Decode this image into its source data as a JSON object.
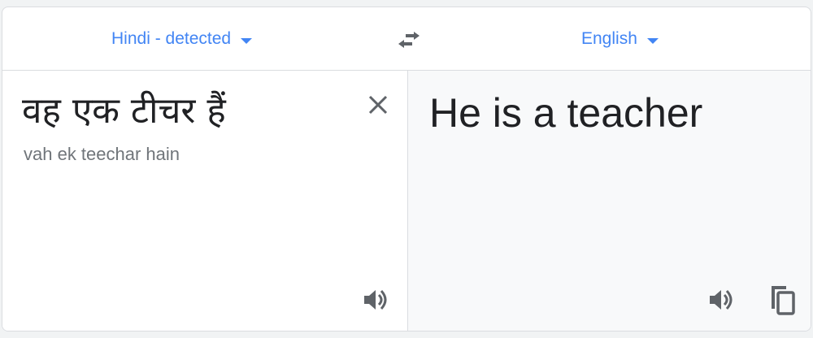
{
  "language_bar": {
    "source_language": "Hindi - detected",
    "target_language": "English",
    "swap_icon": "swap-arrows-icon",
    "accent_color": "#4285f4"
  },
  "source": {
    "text": "वह एक टीचर हैं",
    "transliteration": "vah ek teechar hain",
    "clear_icon": "close-icon",
    "listen_icon": "speaker-icon"
  },
  "target": {
    "text": "He is a teacher",
    "listen_icon": "speaker-icon",
    "copy_icon": "copy-icon",
    "background": "#f8f9fa"
  }
}
